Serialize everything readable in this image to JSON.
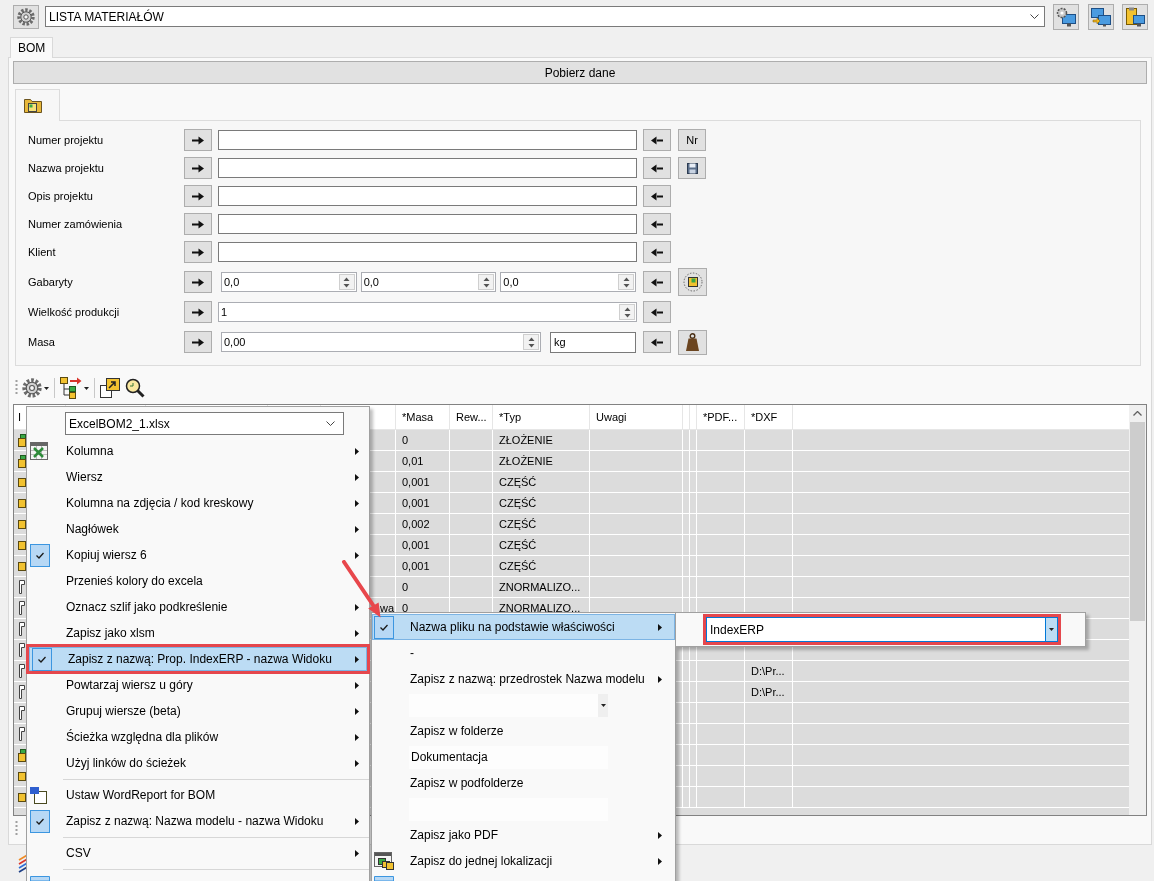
{
  "header": {
    "template": "LISTA MATERIAŁÓW"
  },
  "tabs": [
    {
      "label": "BOM",
      "selected": true
    }
  ],
  "fetch_button": "Pobierz dane",
  "inner_tabs": [
    {
      "selected": true
    }
  ],
  "form": [
    {
      "label": "Numer projektu",
      "kind": "text",
      "extra": {
        "kind": "label",
        "label": "Nr"
      }
    },
    {
      "label": "Nazwa projektu",
      "kind": "text",
      "extra": {
        "kind": "save"
      }
    },
    {
      "label": "Opis projektu",
      "kind": "text"
    },
    {
      "label": "Numer zamówienia",
      "kind": "text"
    },
    {
      "label": "Klient",
      "kind": "text"
    },
    {
      "label": "Gabaryty",
      "kind": "spin",
      "values": [
        "0,0",
        "0,0",
        "0,0"
      ],
      "extra": {
        "kind": "bounding"
      }
    },
    {
      "label": "Wielkość produkcji",
      "kind": "spin",
      "values": [
        "1"
      ]
    },
    {
      "label": "Masa",
      "kind": "spin",
      "values": [
        "0,00"
      ],
      "unit": "kg",
      "extra": {
        "kind": "weight"
      }
    }
  ],
  "table": {
    "columns": {
      "id": "I",
      "masa": "*Masa",
      "rew": "Rew...",
      "typ": "*Typ",
      "uwagi": "Uwagi",
      "pdf": "*PDF...",
      "dxf": "*DXF"
    },
    "rows": [
      {
        "kind": "assembly",
        "masa": "0",
        "typ": "ZŁOŻENIE"
      },
      {
        "kind": "assembly",
        "masa": "0,01",
        "typ": "ZŁOŻENIE"
      },
      {
        "kind": "part",
        "masa": "0,001",
        "typ": "CZĘŚĆ"
      },
      {
        "kind": "part",
        "masa": "0,001",
        "typ": "CZĘŚĆ"
      },
      {
        "kind": "part",
        "masa": "0,002",
        "typ": "CZĘŚĆ"
      },
      {
        "kind": "part",
        "masa": "0,001",
        "typ": "CZĘŚĆ"
      },
      {
        "kind": "part",
        "masa": "0,001",
        "typ": "CZĘŚĆ"
      },
      {
        "kind": "standard",
        "masa": "0",
        "typ": "ZNORMALIZO..."
      },
      {
        "kind": "standard",
        "column_5": "wa",
        "masa": "0",
        "typ": "ZNORMALIZO..."
      },
      {
        "kind": "standard"
      },
      {
        "kind": "standard"
      },
      {
        "kind": "standard",
        "dxf": "D:\\Pr..."
      },
      {
        "kind": "standard",
        "dxf": "D:\\Pr..."
      },
      {
        "kind": "standard"
      },
      {
        "kind": "standard"
      },
      {
        "kind": "assembly"
      },
      {
        "kind": "part"
      },
      {
        "kind": "part"
      }
    ]
  },
  "context_menu": {
    "items": [
      {
        "kind": "combo",
        "value": "ExcelBOM2_1.xlsx"
      },
      {
        "kind": "item",
        "label": "Kolumna",
        "checked": false,
        "selected": false,
        "submenu": true,
        "outlined": false
      },
      {
        "kind": "item",
        "label": "Wiersz",
        "checked": false,
        "selected": false,
        "submenu": true,
        "outlined": false
      },
      {
        "kind": "item",
        "label": "Kolumna na zdjęcia / kod kreskowy",
        "checked": false,
        "selected": false,
        "submenu": true,
        "outlined": false
      },
      {
        "kind": "item",
        "label": "Nagłówek",
        "checked": false,
        "selected": false,
        "submenu": true,
        "outlined": false
      },
      {
        "kind": "item",
        "label": "Kopiuj wiersz 6",
        "checked": true,
        "selected": false,
        "submenu": true,
        "outlined": false
      },
      {
        "kind": "item",
        "label": "Przenieś kolory do excela",
        "checked": false,
        "selected": false,
        "submenu": false,
        "outlined": false
      },
      {
        "kind": "item",
        "label": "Oznacz szlif jako podkreślenie",
        "checked": false,
        "selected": false,
        "submenu": true,
        "outlined": false
      },
      {
        "kind": "item",
        "label": "Zapisz jako xlsm",
        "checked": false,
        "selected": false,
        "submenu": true,
        "outlined": false
      },
      {
        "kind": "item",
        "label": "Zapisz z nazwą: Prop. IndexERP - nazwa Widoku",
        "checked": true,
        "selected": true,
        "submenu": true,
        "outlined": true
      },
      {
        "kind": "item",
        "label": "Powtarzaj wiersz u góry",
        "checked": false,
        "selected": false,
        "submenu": true,
        "outlined": false
      },
      {
        "kind": "item",
        "label": "Grupuj wiersze (beta)",
        "checked": false,
        "selected": false,
        "submenu": true,
        "outlined": false
      },
      {
        "kind": "item",
        "label": "Ścieżka względna dla plików",
        "checked": false,
        "selected": false,
        "submenu": true,
        "outlined": false
      },
      {
        "kind": "item",
        "label": "Użyj linków do ścieżek",
        "checked": false,
        "selected": false,
        "submenu": true,
        "outlined": false
      },
      {
        "kind": "separator"
      },
      {
        "kind": "item",
        "label": "Ustaw WordReport for BOM",
        "checked": false,
        "selected": false,
        "submenu": false,
        "outlined": false
      },
      {
        "kind": "item",
        "label": "Zapisz z nazwą: Nazwa modelu - nazwa Widoku",
        "checked": true,
        "selected": false,
        "submenu": true,
        "outlined": false
      },
      {
        "kind": "separator"
      },
      {
        "kind": "item",
        "label": "CSV",
        "checked": false,
        "selected": false,
        "submenu": true,
        "outlined": false
      },
      {
        "kind": "separator"
      },
      {
        "kind": "item",
        "checked": true,
        "selected": false,
        "submenu": false,
        "outlined": false
      }
    ]
  },
  "submenu": {
    "items": [
      {
        "kind": "item",
        "label": "Nazwa pliku na podstawie właściwości",
        "checked": true,
        "selected": true,
        "submenu": true
      },
      {
        "kind": "item",
        "label": "-",
        "checked": false,
        "selected": false,
        "submenu": false
      },
      {
        "kind": "item",
        "label": "Zapisz z nazwą: przedrostek Nazwa modelu",
        "checked": false,
        "selected": false,
        "submenu": true
      },
      {
        "kind": "combo"
      },
      {
        "kind": "item",
        "label": "Zapisz w folderze",
        "checked": false,
        "selected": false,
        "submenu": false
      },
      {
        "kind": "textbox",
        "value": "Dokumentacja"
      },
      {
        "kind": "item",
        "label": "Zapisz w podfolderze",
        "checked": false,
        "selected": false,
        "submenu": false
      },
      {
        "kind": "textbox"
      },
      {
        "kind": "item",
        "label": "Zapisz jako PDF",
        "checked": false,
        "selected": false,
        "submenu": true
      },
      {
        "kind": "item",
        "label": "Zapisz do jednej lokalizacji",
        "checked": false,
        "selected": false,
        "submenu": true
      },
      {
        "kind": "item",
        "checked": true,
        "selected": false,
        "submenu": false
      }
    ]
  },
  "submenu_2": {
    "value": "IndexERP",
    "outlined": true
  }
}
